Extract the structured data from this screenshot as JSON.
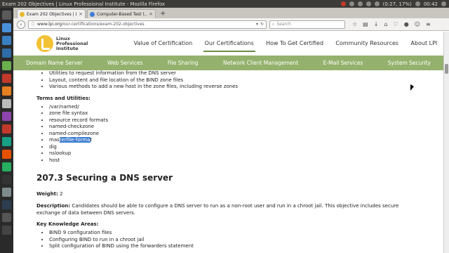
{
  "window": {
    "title": "Exam 202 Objectives | Linux Professional Institute - Mozilla Firefox",
    "tray": {
      "battery": "(0:27, 17%)",
      "clock": "00:42"
    }
  },
  "tabs": [
    {
      "label": "Exam 202 Objectives | Li...",
      "active": true
    },
    {
      "label": "Computer-Based Test (...",
      "active": false
    }
  ],
  "navbar": {
    "url_host": "www.lpi.org",
    "url_path": "/our-certifications/exam-202-objectives",
    "search_placeholder": "Search"
  },
  "site": {
    "logo_line1": "Linux",
    "logo_line2": "Professional",
    "logo_line3": "Institute",
    "main_nav": [
      "Value of Certification",
      "Our Certifications",
      "How To Get Certified",
      "Community Resources",
      "About LPI"
    ],
    "active_nav": "Our Certifications",
    "sub_nav": [
      "Domain Name Server",
      "Web Services",
      "File Sharing",
      "Network Client Management",
      "E-Mail Services",
      "System Security"
    ]
  },
  "content": {
    "top_list": [
      "Utilities to request information from the DNS server",
      "Layout, content and file location of the BIND zone files",
      "Various methods to add a new host in the zone files, including reverse zones"
    ],
    "terms_title": "Terms and Utilities:",
    "terms": [
      "/var/named/",
      "zone file syntax",
      "resource record formats",
      "named-checkzone",
      "named-compilezone",
      "masterfile-format",
      "dig",
      "nslookup",
      "host"
    ],
    "highlight_prefix": "mas",
    "highlight_selected": "terfile-forma",
    "highlight_suffix": "t",
    "section_heading": "207.3 Securing a DNS server",
    "weight_label": "Weight:",
    "weight_value": "2",
    "description_label": "Description:",
    "description_text": "Candidates should be able to configure a DNS server to run as a non-root user and run in a chroot jail. This objective includes secure exchange of data between DNS servers.",
    "kka_title": "Key Knowledge Areas:",
    "kka_list": [
      "BIND 9 configuration files",
      "Configuring BIND to run in a chroot jail",
      "Split configuration of BIND using the forwarders statement"
    ]
  }
}
